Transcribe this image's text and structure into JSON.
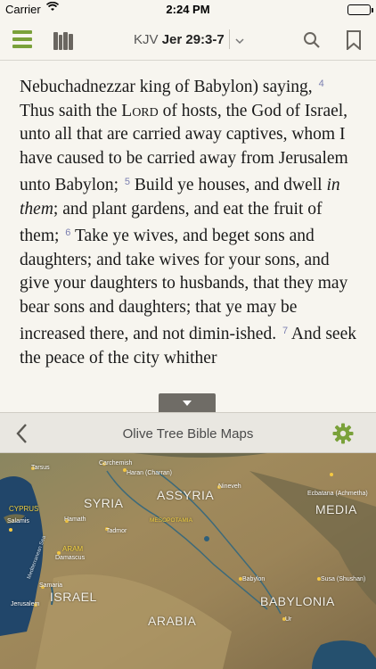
{
  "status_bar": {
    "carrier": "Carrier",
    "time": "2:24 PM"
  },
  "toolbar": {
    "version": "KJV",
    "passage": "Jer 29:3-7",
    "icons": [
      "menu-icon",
      "library-icon",
      "chevron-down-icon",
      "search-icon",
      "bookmark-icon"
    ]
  },
  "bible_text": {
    "intro": "Nebuchadnezzar king of Babylon) saying,",
    "v4_num": "4",
    "v4_a": "Thus saith the ",
    "v4_lord": "Lord",
    "v4_b": " of hosts, the God of Israel, unto all that are carried away captives, whom I have caused to be carried away from Jerusalem unto Babylon;",
    "v5_num": "5",
    "v5_a": "Build ye houses, and dwell ",
    "v5_italic": "in them",
    "v5_b": "; and plant gardens, and eat the fruit of them;",
    "v6_num": "6",
    "v6": "Take ye wives, and beget sons and daughters; and take wives for your sons, and give your daughters to husbands, that they may bear sons and daughters; that ye may be increased there, and not dimin-ished.",
    "v7_num": "7",
    "v7": "And seek the peace of the city whither"
  },
  "map_panel": {
    "title": "Olive Tree Bible Maps",
    "icons": [
      "back-chevron-icon",
      "gear-icon",
      "collapse-arrow-icon"
    ],
    "accent_color": "#7aa13a"
  },
  "map": {
    "regions": {
      "syria": "SYRIA",
      "assyria": "ASSYRIA",
      "media": "MEDIA",
      "israel": "ISRAEL",
      "arabia": "ARABIA",
      "babylonia": "BABYLONIA"
    },
    "cities": {
      "tarsus": "Tarsus",
      "carchemish": "Carchemish",
      "haran": "Haran (Charran)",
      "nineveh": "Nineveh",
      "ecbatana": "Ecbatana (Achmetha)",
      "salamis": "Salamis",
      "hamath": "Hamath",
      "tadmor": "Tadmor",
      "damascus": "Damascus",
      "samaria": "Samaria",
      "jerusalem": "Jerusalem",
      "babylon": "Babylon",
      "susa": "Susa (Shushan)",
      "ur": "Ur"
    },
    "other_labels": {
      "cyprus": "CYPRUS",
      "aram": "ARAM",
      "mesopotamia": "MESOPOTAMIA",
      "mediterranean": "Mediterranean Sea"
    }
  }
}
